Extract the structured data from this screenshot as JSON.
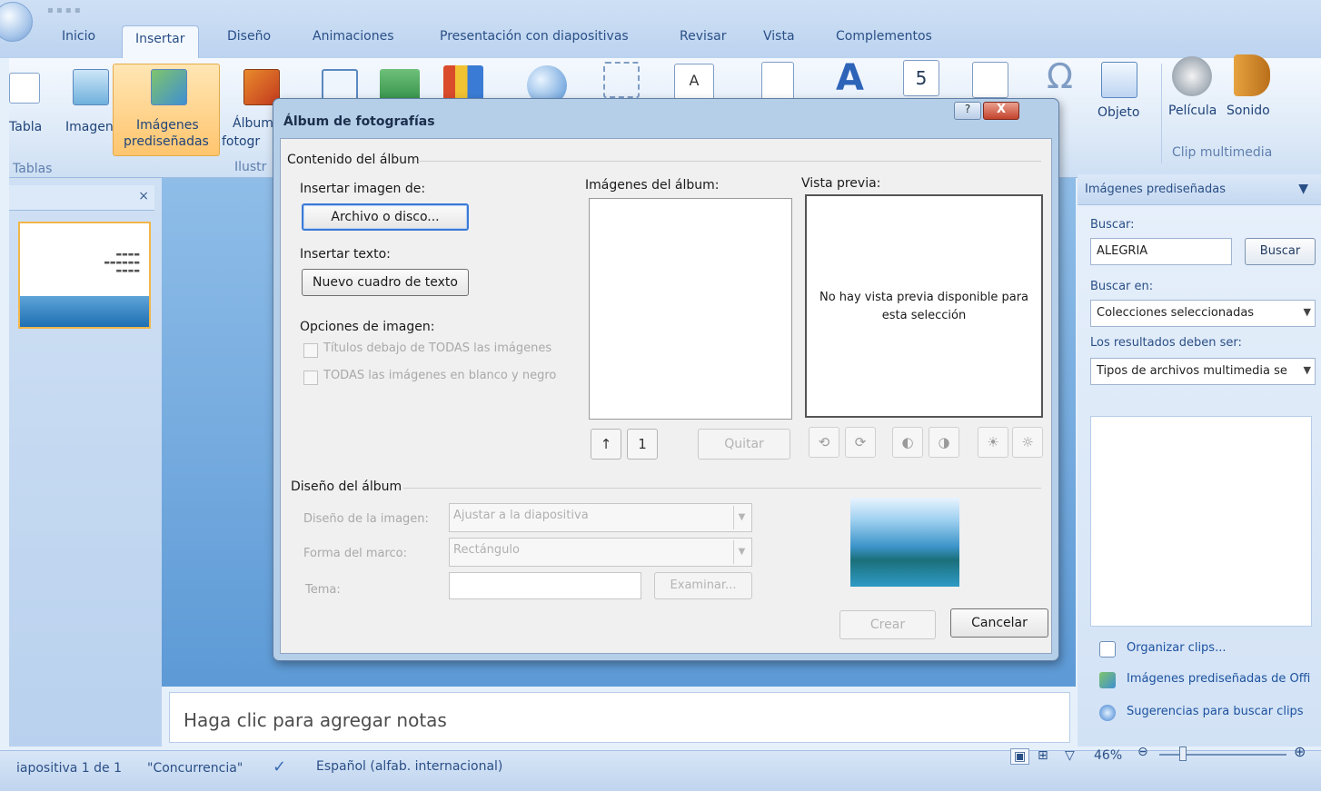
{
  "ribbon": {
    "tabs": [
      "Inicio",
      "Insertar",
      "Diseño",
      "Animaciones",
      "Presentación con diapositivas",
      "Revisar",
      "Vista",
      "Complementos"
    ],
    "active_tab": "Insertar",
    "buttons": {
      "table": "Tabla",
      "image": "Imagen",
      "clipart_line1": "Imágenes",
      "clipart_line2": "prediseñadas",
      "album_line1": "Álbum",
      "album_line2": "fotogr",
      "object": "Objeto",
      "movie": "Película",
      "sound": "Sonido"
    },
    "groups": {
      "tables": "Tablas",
      "illustrations": "Ilustr",
      "media": "Clip multimedia"
    }
  },
  "dialog": {
    "title": "Álbum de fotografías",
    "close_label": "X",
    "help_label": "?",
    "section_content": "Contenido del álbum",
    "insert_image_label": "Insertar imagen de:",
    "file_button": "Archivo o disco...",
    "insert_text_label": "Insertar texto:",
    "new_textbox_button": "Nuevo cuadro de texto",
    "image_options_label": "Opciones de imagen:",
    "option_titles": "Títulos debajo de TODAS las imágenes",
    "option_bw": "TODAS las imágenes en blanco y negro",
    "album_images_label": "Imágenes del álbum:",
    "preview_label": "Vista previa:",
    "preview_text": "No hay vista previa disponible para esta selección",
    "move_up": "↑",
    "move_down": "1",
    "remove_button": "Quitar",
    "section_layout": "Diseño del álbum",
    "image_layout_label": "Diseño de la imagen:",
    "image_layout_value": "Ajustar a la diapositiva",
    "frame_shape_label": "Forma del marco:",
    "frame_shape_value": "Rectángulo",
    "theme_label": "Tema:",
    "browse_button": "Examinar...",
    "create_button": "Crear",
    "cancel_button": "Cancelar"
  },
  "taskpane": {
    "title": "Imágenes prediseñadas",
    "search_label": "Buscar:",
    "search_value": "ALEGRIA",
    "search_button": "Buscar",
    "search_in_label": "Buscar en:",
    "search_in_value": "Colecciones seleccionadas",
    "results_label": "Los resultados deben ser:",
    "results_value": "Tipos de archivos multimedia se",
    "links": [
      "Organizar clips...",
      "Imágenes prediseñadas de Offi",
      "Sugerencias para buscar clips"
    ]
  },
  "notes": {
    "placeholder": "Haga clic para agregar notas"
  },
  "statusbar": {
    "slide": "iapositiva 1 de 1",
    "theme": "\"Concurrencia\"",
    "language": "Español (alfab. internacional)",
    "zoom": "46%"
  }
}
